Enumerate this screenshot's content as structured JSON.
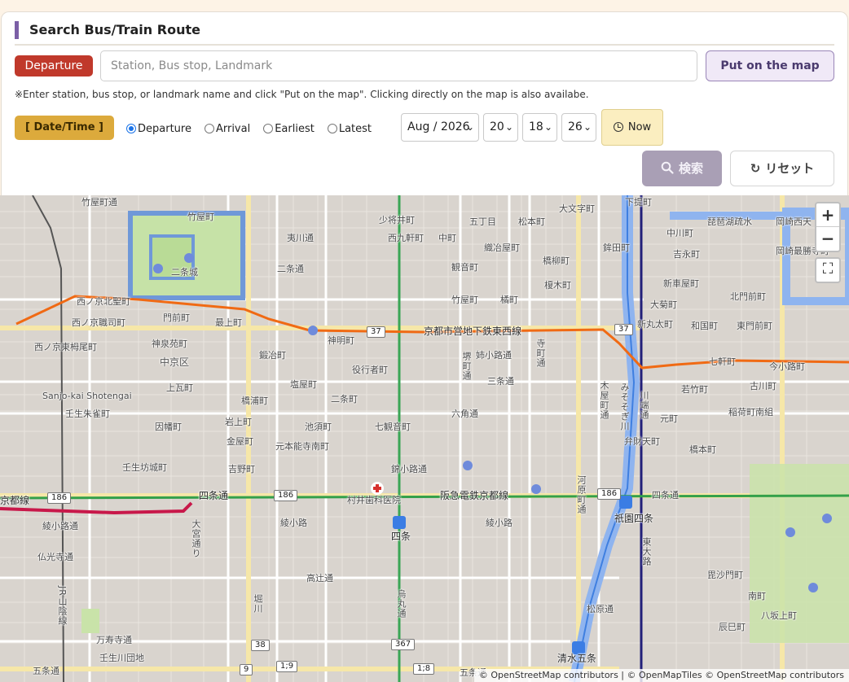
{
  "header": {
    "title": "Search Bus/Train Route"
  },
  "departure": {
    "badge": "Departure",
    "placeholder": "Station, Bus stop, Landmark",
    "put_on_map_label": "Put on the map"
  },
  "hint": "※Enter station, bus stop, or landmark name and click \"Put on the map\". Clicking directly on the map is also availabe.",
  "datetime": {
    "badge": "[ Date/Time ]",
    "modes": [
      {
        "label": "Departure",
        "checked": true
      },
      {
        "label": "Arrival",
        "checked": false
      },
      {
        "label": "Earliest",
        "checked": false
      },
      {
        "label": "Latest",
        "checked": false
      }
    ],
    "month": "Aug / 2026",
    "day": "20",
    "hour": "18",
    "minute": "26",
    "now_label": "Now"
  },
  "actions": {
    "search_label": "検索",
    "reset_label": "リセット"
  },
  "map": {
    "zoom_in": "+",
    "zoom_out": "−",
    "fullscreen": "⛶",
    "attribution": "© OpenStreetMap contributors | © OpenMapTiles © OpenStreetMap contributors",
    "route_badges": [
      "37",
      "37",
      "186",
      "186",
      "186",
      "38",
      "367",
      "9",
      "1;9",
      "1;8"
    ],
    "labels": {
      "nijojo": "二条城",
      "takeyamachi_dori": "竹屋町通",
      "takeyamachi": "竹屋町",
      "shoshoimachi": "少将井町",
      "gochome": "五丁目",
      "matsumotocho": "松本町",
      "daimonjicho": "大文字町",
      "shimotsutsumi": "下提町",
      "biwako_sosui": "琵琶湖疏水",
      "okazaki_nishi": "岡崎西天",
      "nishi_kuken": "西九軒町",
      "nakamachi": "中町",
      "oriyamachi": "織冶屋町",
      "kakida": "鉾田町",
      "nakagawa": "中川町",
      "okazaki_mogami": "岡崎最勝寺町",
      "ebisukawa_dori": "夷川通",
      "kanyakucho": "観音町",
      "hashiyamacho": "橋柳町",
      "yoshinagacho": "吉永町",
      "nijo_dori": "二条通",
      "kitamae": "北門前町",
      "nishinokyo_kitasei": "西ノ京北聖町",
      "nishinokyo_shokushi": "西ノ京職司町",
      "monzen": "門前町",
      "mogami": "最上町",
      "takeyamachi2": "竹屋町",
      "tachibana": "橘町",
      "enokicho": "榎木町",
      "shintoyocho": "新車屋町",
      "okikucho": "大菊町",
      "shinmaruta": "新丸太町",
      "wakamiyacho": "和国町",
      "higashimon": "東門前町",
      "tozai_line": "京都市営地下鉄東西線",
      "shinmeicho": "神明町",
      "kamisenen": "神泉苑町",
      "nakagyo": "中京区",
      "nishinokyo_higashi": "西ノ京東栂尾町",
      "kajiyamachi": "鍛冶町",
      "sakai_dori": "堺町通",
      "shijo_koji": "姉小路通",
      "teramachi": "寺町通",
      "sanjo_ohashi": "三条大橋",
      "shichikenmachi": "七軒町",
      "imakoji": "今小路町",
      "sanjo_kai": "Sanjo-kai Shotengai",
      "kamigyocho": "上瓦町",
      "yakushamachi": "役行者町",
      "shiomachi": "塩屋町",
      "sanjo_dori": "三条通",
      "wakatake": "若竹町",
      "furukawa": "古川町",
      "mibu_shujaku": "壬生朱雀町",
      "hashiuracho": "橋浦町",
      "nijomachi": "二条町",
      "rokkaku": "六角通",
      "inarimachi": "稲荷町南組",
      "innanmachi": "因幡町",
      "iwagami": "岩上町",
      "ikesu": "池須町",
      "shichikannon": "七観音町",
      "motomachi": "元町",
      "kinyamachi": "金屋町",
      "motonomachi": "元本能寺南町",
      "bentencho": "弁財天町",
      "hashimotocho": "橋本町",
      "mibu_bojo": "壬生坊城町",
      "yoshinocho": "吉野町",
      "nishikikoji": "錦小路通",
      "shijo_dori": "四条通",
      "hankyu": "阪急電鉄京都線",
      "kyoto_line": "京都線",
      "murai": "村井歯科医院",
      "shijo_station": "四条",
      "ryogoku": "綾小路",
      "ayakoji": "綾小路通",
      "gion_shijo": "祇園四条",
      "bukkoji": "仏光寺通",
      "takatsuji": "高辻通",
      "higashi_odo": "東大路",
      "manjuji": "万寿寺通",
      "mibu_danchi": "壬生川団地",
      "gojo_dori": "五条通",
      "gojo": "五条通",
      "kiyomizu_gojo": "清水五条",
      "matsubara": "松原通",
      "hachisaka": "八坂上町",
      "tatsumi": "辰巳町",
      "minami": "南町",
      "kaiyaki": "毘沙門町",
      "kawabata": "川端通",
      "kiyamachi": "木屋町通",
      "kawaramachi": "河原町通",
      "horikawa": "堀川",
      "misogi": "みそそぎ川",
      "karasuma": "烏丸通",
      "omiya": "大宮通り",
      "jr_line": "JR山陰線"
    }
  }
}
